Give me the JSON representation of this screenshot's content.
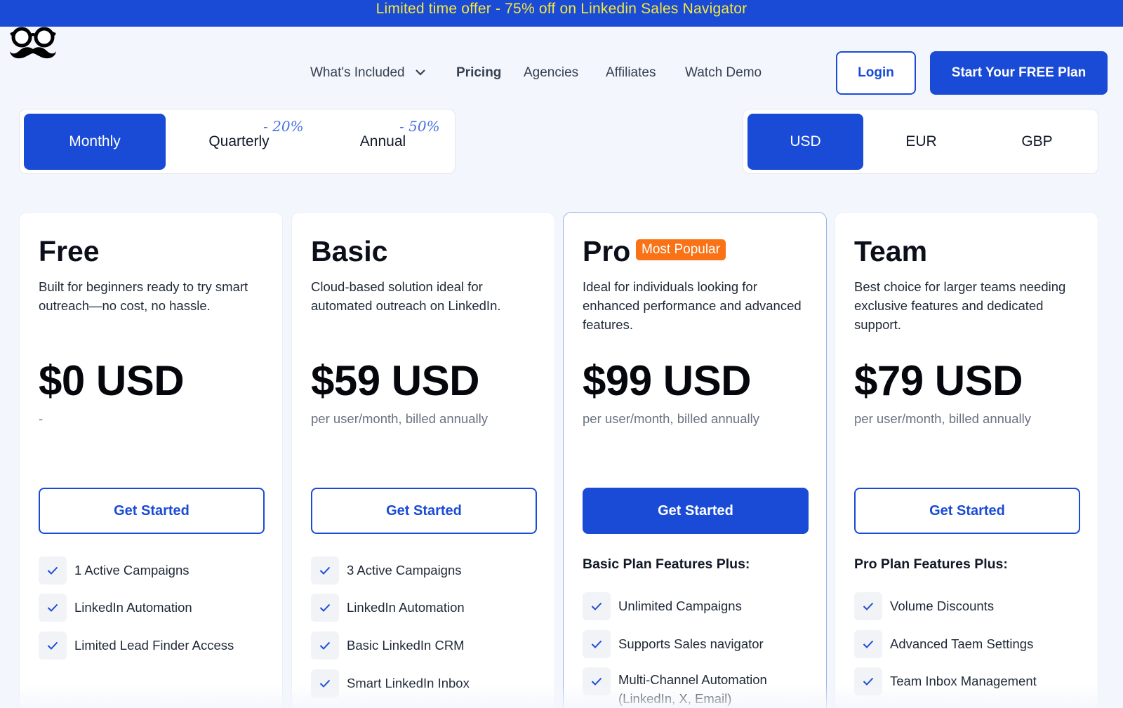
{
  "promo": {
    "text": "Limited time offer - 75% off on Linkedin Sales Navigator"
  },
  "nav": {
    "whats_included": "What's Included",
    "pricing": "Pricing",
    "agencies": "Agencies",
    "affiliates": "Affiliates",
    "watch_demo": "Watch Demo"
  },
  "auth": {
    "login": "Login",
    "start": "Start Your FREE Plan"
  },
  "billing_toggle": {
    "monthly": "Monthly",
    "quarterly": "Quarterly",
    "quarterly_discount": "- 20%",
    "annual": "Annual",
    "annual_discount": "- 50%",
    "selected": "Monthly"
  },
  "currency_toggle": {
    "usd": "USD",
    "eur": "EUR",
    "gbp": "GBP",
    "selected": "USD"
  },
  "colors": {
    "brand": "#1a4bd6",
    "promo_text": "#f5e73c",
    "badge": "#f97316"
  },
  "plans": [
    {
      "name": "Free",
      "description": "Built for beginners ready to try smart outreach—no cost, no hassle.",
      "price": "$0 USD",
      "billing": "-",
      "cta": "Get Started",
      "features_heading": "",
      "features": [
        "1 Active Campaigns",
        "LinkedIn Automation",
        "Limited Lead Finder Access"
      ]
    },
    {
      "name": "Basic",
      "description": "Cloud-based solution ideal for automated outreach on LinkedIn.",
      "price": "$59 USD",
      "billing": "per user/month, billed annually",
      "cta": "Get Started",
      "features_heading": "",
      "features": [
        "3 Active Campaigns",
        "LinkedIn Automation",
        "Basic LinkedIn CRM",
        "Smart LinkedIn Inbox"
      ]
    },
    {
      "name": "Pro",
      "badge": "Most Popular",
      "description": "Ideal for individuals looking for enhanced performance and advanced features.",
      "price": "$99 USD",
      "billing": "per user/month, billed annually",
      "cta": "Get Started",
      "features_heading": "Basic Plan Features Plus:",
      "features": [
        "Unlimited Campaigns",
        "Supports Sales navigator",
        "Multi-Channel Automation (LinkedIn, X, Email)"
      ]
    },
    {
      "name": "Team",
      "description": "Best choice for larger teams needing exclusive features and dedicated support.",
      "price": "$79 USD",
      "billing": "per user/month, billed annually",
      "cta": "Get Started",
      "features_heading": "Pro Plan Features Plus:",
      "features": [
        "Volume Discounts",
        "Advanced Taem Settings",
        "Team Inbox Management"
      ]
    }
  ]
}
